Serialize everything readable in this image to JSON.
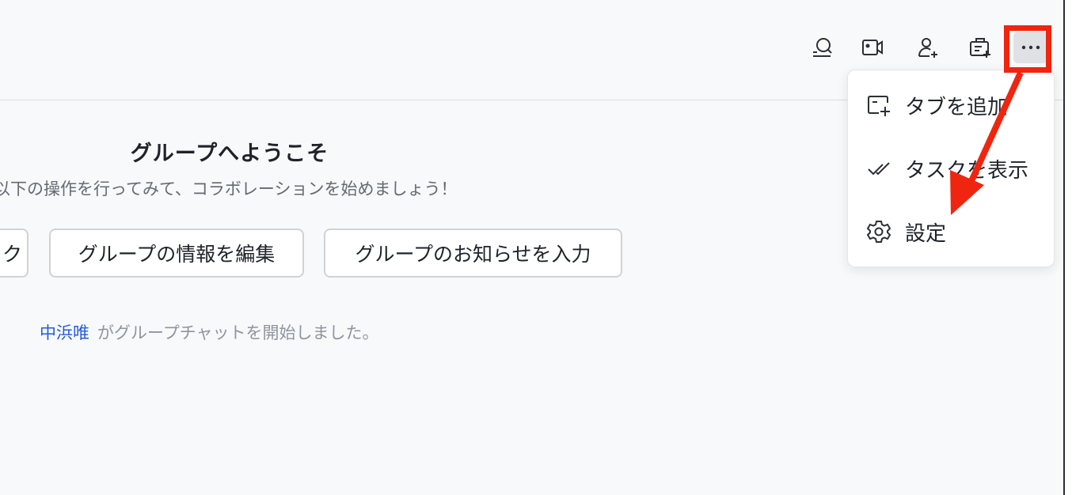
{
  "toolbar": {
    "icons": [
      "search-chat-icon",
      "video-call-icon",
      "add-member-icon",
      "add-tab-icon",
      "more-icon"
    ]
  },
  "welcome": {
    "title": "グループへようこそ",
    "subtitle": "以下の操作を行ってみて、コラボレーションを始めましょう！"
  },
  "quick_actions": [
    {
      "label": "ク"
    },
    {
      "label": "グループの情報を編集"
    },
    {
      "label": "グループのお知らせを入力"
    }
  ],
  "system_message": {
    "user": "中浜唯",
    "text": "がグループチャットを開始しました。"
  },
  "more_menu": {
    "items": [
      {
        "label": "タブを追加",
        "icon": "add-tab-icon"
      },
      {
        "label": "タスクを表示",
        "icon": "task-icon"
      },
      {
        "label": "設定",
        "icon": "gear-icon"
      }
    ]
  },
  "annotation": {
    "highlight_color": "#f0250f"
  }
}
